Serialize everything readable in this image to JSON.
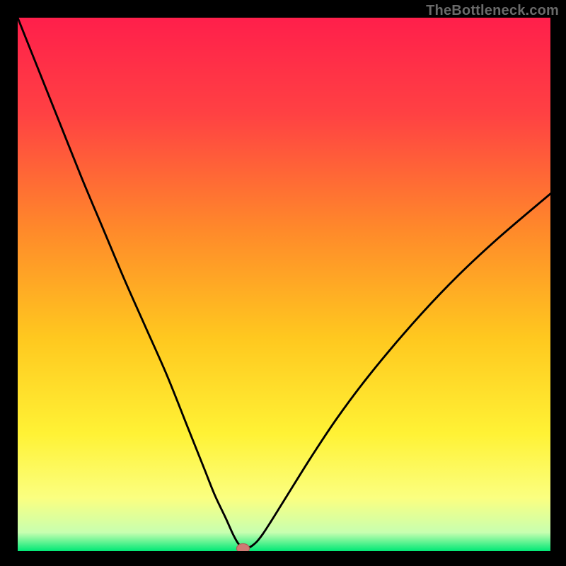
{
  "watermark": "TheBottleneck.com",
  "colors": {
    "frame": "#000000",
    "curve": "#000000",
    "marker_fill": "#cf7a74",
    "marker_stroke": "#b25a55",
    "gradient_stops": [
      {
        "offset": 0.0,
        "color": "#ff1f4b"
      },
      {
        "offset": 0.18,
        "color": "#ff4143"
      },
      {
        "offset": 0.4,
        "color": "#ff8a2a"
      },
      {
        "offset": 0.6,
        "color": "#ffc81f"
      },
      {
        "offset": 0.78,
        "color": "#fff235"
      },
      {
        "offset": 0.9,
        "color": "#fbff80"
      },
      {
        "offset": 0.965,
        "color": "#c8ffb0"
      },
      {
        "offset": 1.0,
        "color": "#00e876"
      }
    ]
  },
  "chart_data": {
    "type": "line",
    "title": "",
    "xlabel": "",
    "ylabel": "",
    "xlim": [
      0,
      100
    ],
    "ylim": [
      0,
      100
    ],
    "grid": false,
    "legend": false,
    "series": [
      {
        "name": "bottleneck-curve",
        "x": [
          0,
          4,
          8,
          12,
          16,
          20,
          24,
          28,
          32,
          35,
          37,
          39,
          40.5,
          41.5,
          42.5,
          44,
          46,
          50,
          55,
          60,
          66,
          74,
          82,
          90,
          100
        ],
        "y": [
          100,
          90,
          80,
          70,
          60.5,
          51,
          42,
          33,
          23,
          15.5,
          10.5,
          6.3,
          3.0,
          1.3,
          0.6,
          1.0,
          3.2,
          9.5,
          17.5,
          25.0,
          33.0,
          42.5,
          51.0,
          58.5,
          67.0
        ]
      }
    ],
    "marker": {
      "name": "optimal-point",
      "x": 42.3,
      "y": 0.5,
      "rx": 1.2,
      "ry": 0.9
    }
  }
}
